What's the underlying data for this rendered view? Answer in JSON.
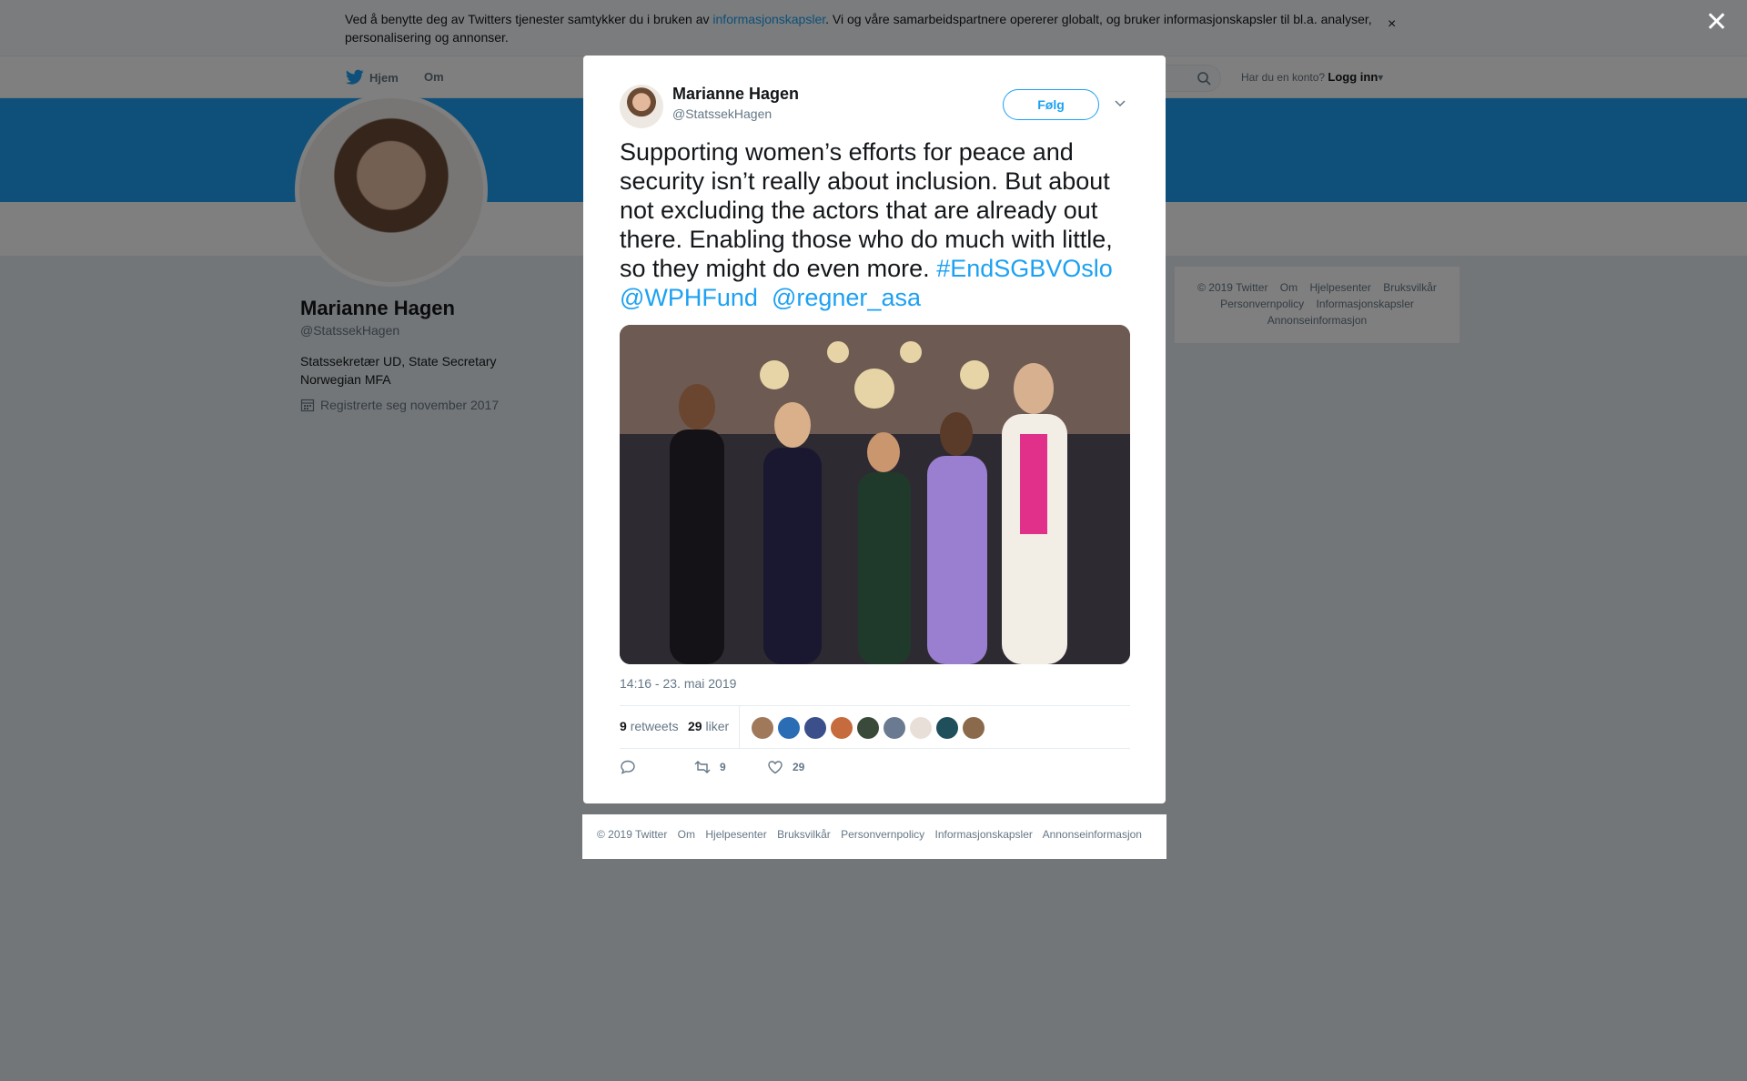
{
  "cookie_banner": {
    "text_before": "Ved å benytte deg av Twitters tjenester samtykker du i bruken av ",
    "link_text": "informasjonskapsler",
    "text_after": ". Vi og våre samarbeidspartnere opererer globalt, og bruker informasjonskapsler til bl.a. analyser, personalisering og annonser.",
    "close": "×"
  },
  "topnav": {
    "home": "Hjem",
    "about": "Om",
    "account_prompt": "Har du en konto?",
    "login": "Logg inn",
    "login_caret": "▾"
  },
  "profile": {
    "name": "Marianne Hagen",
    "handle": "@StatssekHagen",
    "bio": "Statssekretær UD, State Secretary Norwegian MFA",
    "joined": "Registrerte seg november 2017"
  },
  "side_footer": {
    "items": [
      "© 2019 Twitter",
      "Om",
      "Hjelpesenter",
      "Bruksvilkår",
      "Personvernpolicy",
      "Informasjonskapsler",
      "Annonseinformasjon"
    ]
  },
  "overlay": {
    "close": "✕"
  },
  "tweet": {
    "author_name": "Marianne Hagen",
    "author_handle": "@StatssekHagen",
    "follow_label": "Følg",
    "text": "Supporting women’s efforts for peace and security isn’t really about inclusion. But about not excluding the actors that are already out there. Enabling those who do much with little, so they might do even more. ",
    "hashtag": "#EndSGBVOslo",
    "mention1": "@WPHFund",
    "mention2": "@regner_asa",
    "timestamp": "14:16 - 23. mai 2019",
    "retweets_count": "9",
    "retweets_label": "retweets",
    "likes_count": "29",
    "likes_label": "liker",
    "action_retweets": "9",
    "action_likes": "29",
    "liker_colors": [
      "#a0785a",
      "#2a6db5",
      "#3b4f8a",
      "#c66b3d",
      "#3a4a3a",
      "#6a7a90",
      "#e8e0d8",
      "#1f4f5a",
      "#8a6a4a"
    ]
  },
  "modal_footer": {
    "items": [
      "© 2019 Twitter",
      "Om",
      "Hjelpesenter",
      "Bruksvilkår",
      "Personvernpolicy",
      "Informasjonskapsler",
      "Annonseinformasjon"
    ]
  },
  "colors": {
    "brand": "#1da1f2",
    "overlay": "#000000"
  }
}
